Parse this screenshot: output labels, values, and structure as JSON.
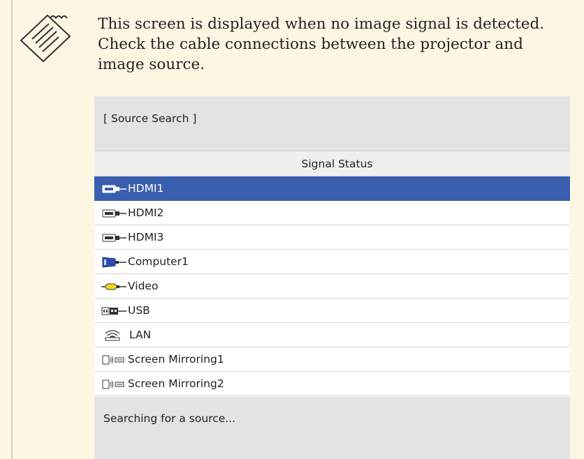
{
  "note": {
    "text": "This screen is displayed when no image signal is detected. Check the cable connections between the projector and image source."
  },
  "panel": {
    "title": "[ Source Search ]",
    "column_header": "Signal Status",
    "sources": [
      {
        "label": "HDMI1",
        "icon": "hdmi-icon",
        "selected": true
      },
      {
        "label": "HDMI2",
        "icon": "hdmi-icon",
        "selected": false
      },
      {
        "label": "HDMI3",
        "icon": "hdmi-icon",
        "selected": false
      },
      {
        "label": "Computer1",
        "icon": "vga-computer-icon",
        "selected": false
      },
      {
        "label": "Video",
        "icon": "rca-video-icon",
        "selected": false
      },
      {
        "label": "USB",
        "icon": "usb-icon",
        "selected": false
      },
      {
        "label": "LAN",
        "icon": "lan-icon",
        "selected": false
      },
      {
        "label": "Screen Mirroring1",
        "icon": "screen-mirroring-icon",
        "selected": false
      },
      {
        "label": "Screen Mirroring2",
        "icon": "screen-mirroring-icon",
        "selected": false
      }
    ],
    "status": "Searching for a source..."
  },
  "colors": {
    "note_background": "#fdf6e3",
    "selection": "#3a5fb0",
    "header_gray": "#e3e3e3"
  }
}
